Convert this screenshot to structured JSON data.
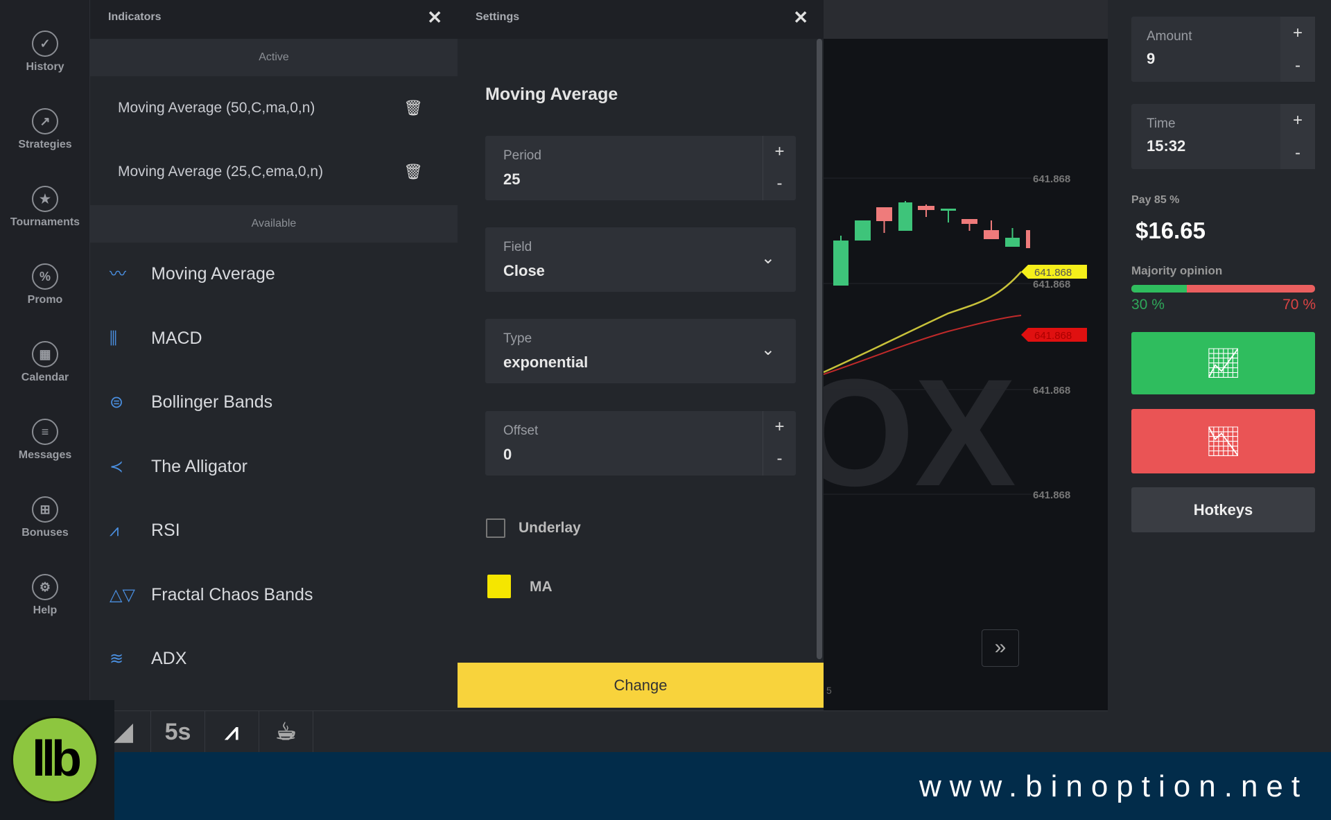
{
  "sidebar": {
    "items": [
      {
        "label": "History",
        "icon": "check-circle-icon",
        "glyph": "✓"
      },
      {
        "label": "Strategies",
        "icon": "trend-icon",
        "glyph": "↗"
      },
      {
        "label": "Tournaments",
        "icon": "trophy-icon",
        "glyph": "★"
      },
      {
        "label": "Promo",
        "icon": "percent-icon",
        "glyph": "%"
      },
      {
        "label": "Calendar",
        "icon": "calendar-icon",
        "glyph": "▦"
      },
      {
        "label": "Messages",
        "icon": "messages-icon",
        "glyph": "≡"
      },
      {
        "label": "Bonuses",
        "icon": "gift-icon",
        "glyph": "⊞"
      },
      {
        "label": "Help",
        "icon": "help-icon",
        "glyph": "⚙"
      }
    ]
  },
  "indicators": {
    "title": "Indicators",
    "close": "✕",
    "active_label": "Active",
    "available_label": "Available",
    "active": [
      {
        "label": "Moving Average (50,C,ma,0,n)"
      },
      {
        "label": "Moving Average (25,C,ema,0,n)"
      }
    ],
    "available": [
      {
        "label": "Moving Average",
        "glyph": "〰"
      },
      {
        "label": "MACD",
        "glyph": "⫼"
      },
      {
        "label": "Bollinger Bands",
        "glyph": "⊜"
      },
      {
        "label": "The Alligator",
        "glyph": "≺"
      },
      {
        "label": "RSI",
        "glyph": "⩘"
      },
      {
        "label": "Fractal Chaos Bands",
        "glyph": "△▽"
      },
      {
        "label": "ADX",
        "glyph": "≋"
      }
    ]
  },
  "settings": {
    "title": "Settings",
    "close": "✕",
    "heading": "Moving Average",
    "period": {
      "label": "Period",
      "value": "25"
    },
    "field": {
      "label": "Field",
      "value": "Close"
    },
    "type": {
      "label": "Type",
      "value": "exponential"
    },
    "offset": {
      "label": "Offset",
      "value": "0"
    },
    "underlay": {
      "label": "Underlay",
      "checked": false
    },
    "ma": {
      "label": "MA",
      "color": "#f5e600"
    },
    "change_label": "Change",
    "plus": "+",
    "minus": "-",
    "chevron": "⌄"
  },
  "chart": {
    "price_labels": [
      "641.868",
      "641.868",
      "641.868",
      "641.868"
    ],
    "yellow_tag": "641.868",
    "red_tag": "641.868",
    "watermark": "OX",
    "forward": "»",
    "time_fragment": "5",
    "colors": {
      "up": "#3ec47a",
      "down": "#ef7b7b",
      "ma_yellow": "#c8c23a",
      "ma_red": "#c02a2a"
    }
  },
  "trade": {
    "amount": {
      "label": "Amount",
      "value": "9"
    },
    "time": {
      "label": "Time",
      "value": "15:32"
    },
    "pay_label": "Pay 85 %",
    "payout": "$16.65",
    "majority_label": "Majority opinion",
    "majority_up_pct": 30,
    "up_text": "30 %",
    "down_text": "70 %",
    "hotkeys": "Hotkeys",
    "colors": {
      "up": "#2fbd5e",
      "down": "#ea5455"
    }
  },
  "toolbar": {
    "timeframe": "5s"
  },
  "banner": {
    "url": "www.binoption.net",
    "logo": "llb"
  }
}
